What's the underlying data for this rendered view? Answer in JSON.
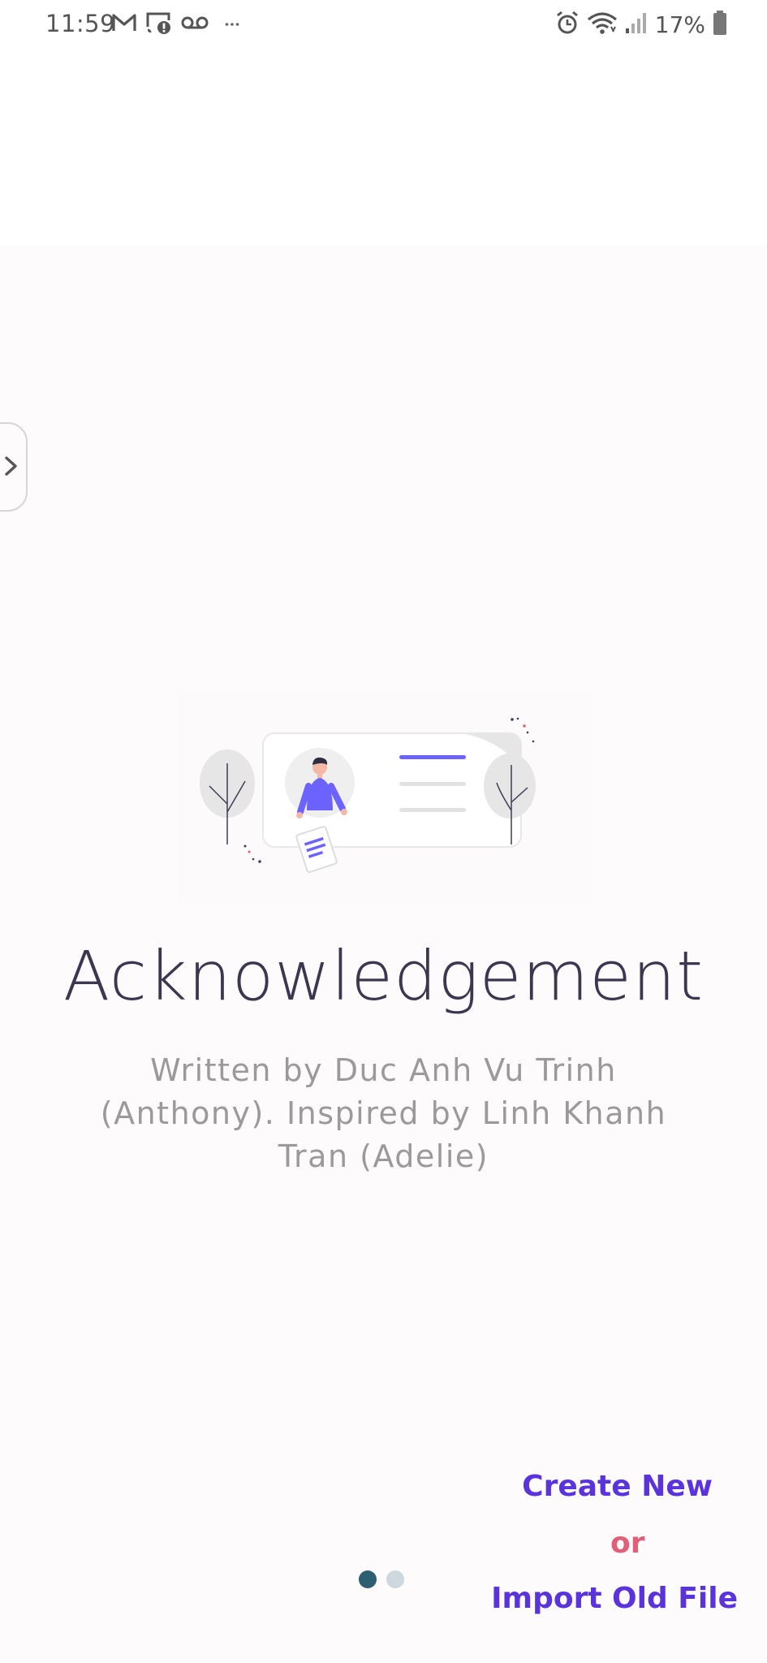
{
  "status_bar": {
    "time": "11:59",
    "battery": "17%",
    "left_icons": [
      "gmail-icon",
      "cast-alert-icon",
      "voicemail-icon",
      "more-dots-icon"
    ],
    "right_icons": [
      "alarm-icon",
      "wifi-icon",
      "signal-icon",
      "battery-icon"
    ]
  },
  "header": {
    "theme_toggle_icon": "moon-icon"
  },
  "side_panel": {
    "handle_icon": "chevron-right-icon"
  },
  "onboarding": {
    "title": "Acknowledgement",
    "subtitle_lines": [
      "Written by Duc Anh Vu Trinh",
      "(Anthony). Inspired by Linh Khanh",
      "Tran (Adelie)"
    ],
    "page_count": 2,
    "active_page": 1
  },
  "actions": {
    "create_label": "Create New",
    "or_label": "or",
    "import_label": "Import Old File"
  },
  "colors": {
    "accent": "#5a33dd",
    "or_text": "#e0607a",
    "title": "#3b3751",
    "subtitle": "#9b9999",
    "dot_active": "#2e5e72",
    "dot_inactive": "#ccd7de",
    "illustration_purple": "#6c63ff"
  }
}
